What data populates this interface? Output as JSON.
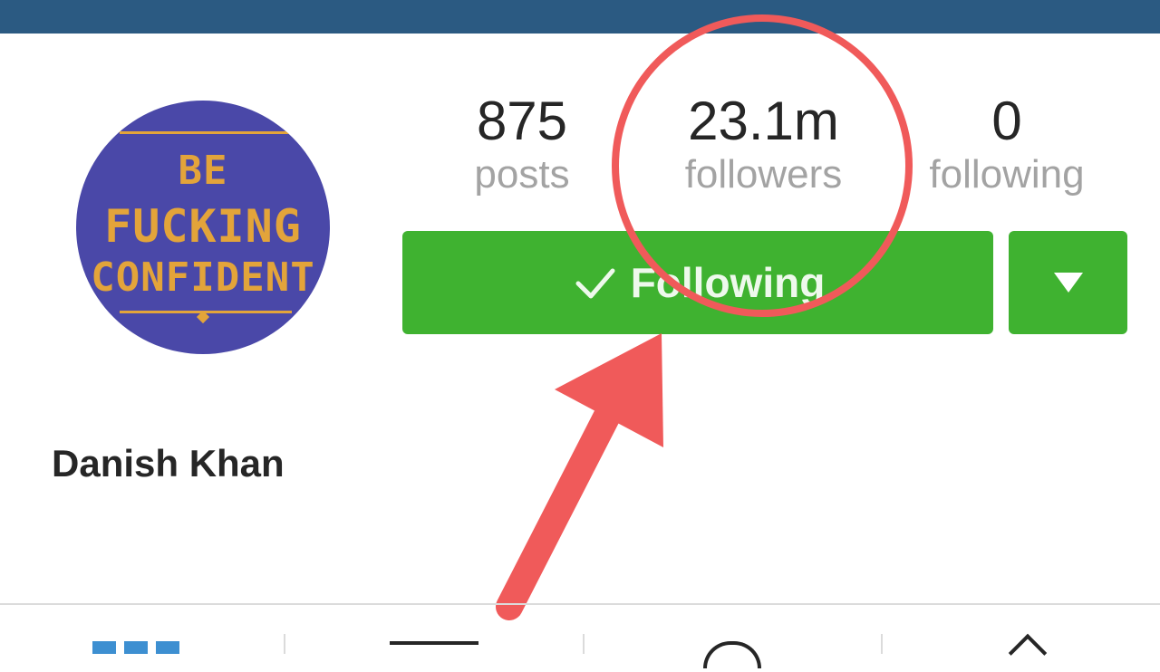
{
  "profile": {
    "avatar_text": [
      "BE",
      "FUCKING",
      "CONFIDENT"
    ],
    "name": "Danish Khan"
  },
  "stats": {
    "posts": {
      "value": "875",
      "label": "posts"
    },
    "followers": {
      "value": "23.1m",
      "label": "followers"
    },
    "following": {
      "value": "0",
      "label": "following"
    }
  },
  "actions": {
    "following_label": "Following",
    "check_icon": "checkmark-icon",
    "dropdown_icon": "triangle-down-icon"
  },
  "tabs": [
    {
      "icon": "grid-icon"
    },
    {
      "icon": "list-icon"
    },
    {
      "icon": "person-tag-icon"
    },
    {
      "icon": "bookmark-icon"
    }
  ],
  "colors": {
    "topbar": "#2b5a82",
    "button_green": "#3fb230",
    "annotation_red": "#f05a5a",
    "avatar_bg": "#4a48a8",
    "avatar_text": "#e3a43a"
  }
}
